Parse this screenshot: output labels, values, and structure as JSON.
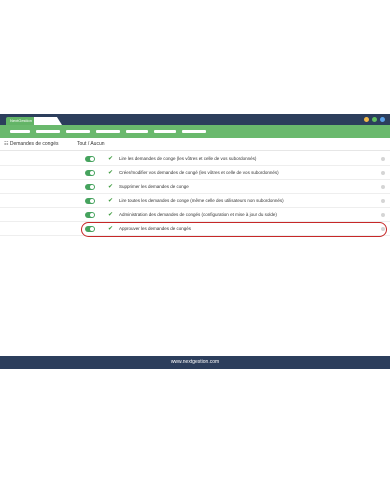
{
  "app": {
    "brand_tab": "NextGestion",
    "colors": {
      "titlebar": "#2c3e5c",
      "navbar": "#6ab96d",
      "toggle_on": "#46a35e",
      "highlight": "#c62828"
    },
    "window_controls": [
      "#f0b84a",
      "#5fbf5f",
      "#5aa0e6"
    ]
  },
  "table": {
    "section_label": "Demandes de congés",
    "toggle_all_label": "Tout / Aucun",
    "rows": [
      {
        "label": "Lire les demandes de conge (les vôtres et celle de vos subordonnés)",
        "enabled": true
      },
      {
        "label": "Créer/modifier vos demandes de congé (les vôtres et celle de vos subordonnés)",
        "enabled": true
      },
      {
        "label": "Supprimer les demandes de conge",
        "enabled": true
      },
      {
        "label": "Lire toutes les demandes de conge (même celle des utilisateurs non subordonnés)",
        "enabled": true
      },
      {
        "label": "Administration des demandes de congés (configuration et mise à jour du solde)",
        "enabled": true
      },
      {
        "label": "Approuver les demandes de congés",
        "enabled": true,
        "highlighted": true
      }
    ]
  },
  "footer": {
    "text": "www.nextgestion.com"
  }
}
